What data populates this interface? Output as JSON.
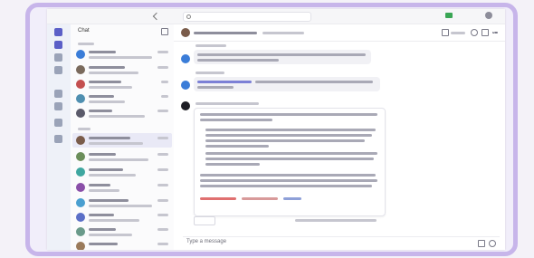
{
  "chat_list": {
    "header": "Chat"
  },
  "compose": {
    "placeholder": "Type a message"
  },
  "colors": {
    "frame_border": "#c7b5ea",
    "accent": "#5b5fc7",
    "rail_background": "#eef1f8",
    "bubble_background": "#f1f1f5",
    "presence_green": "#3aa655"
  },
  "icons": {
    "list_header": "compose-icon",
    "rail": [
      "activity-icon",
      "chat-icon",
      "teams-icon",
      "calendar-icon",
      "calls-icon",
      "files-icon",
      "apps-icon",
      "help-icon"
    ],
    "header_right": [
      "video-call-icon",
      "audio-call-icon",
      "screen-share-icon",
      "more-icon"
    ]
  }
}
